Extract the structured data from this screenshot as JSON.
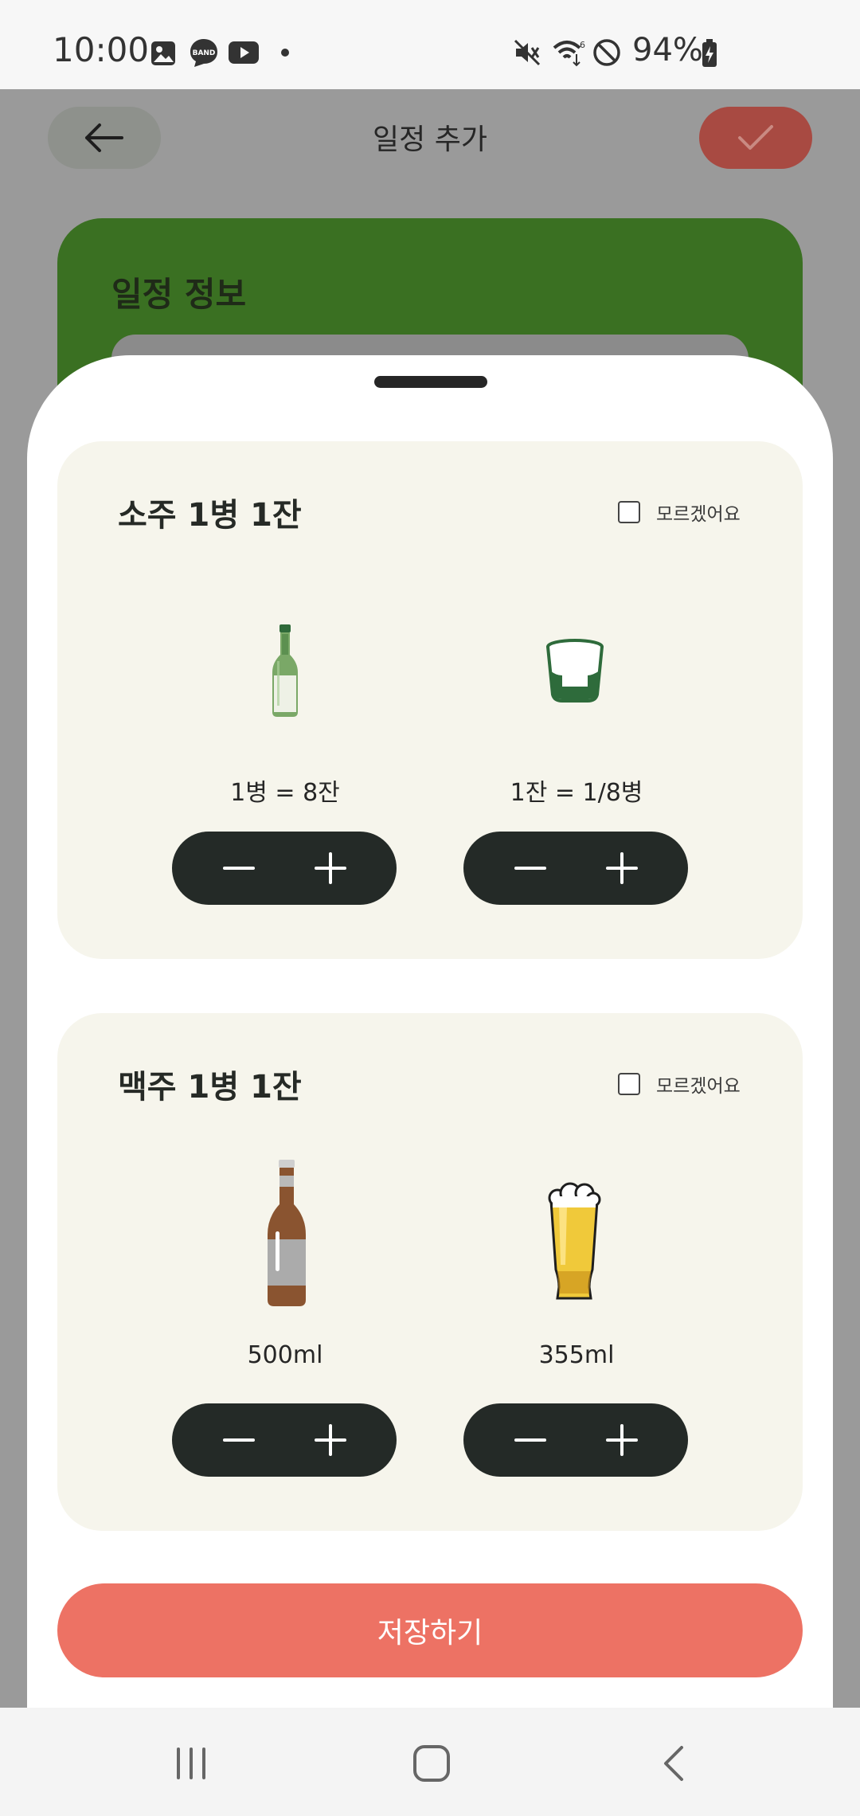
{
  "status_bar": {
    "time": "10:00",
    "battery": "94%",
    "icons_left": [
      "gallery-icon",
      "band-icon",
      "youtube-icon",
      "dot-icon"
    ],
    "icons_right": [
      "mute-icon",
      "wifi-icon",
      "do-not-disturb-icon",
      "battery-charging-icon"
    ]
  },
  "header": {
    "title": "일정 추가",
    "back_icon": "arrow-left-icon",
    "confirm_icon": "check-icon"
  },
  "schedule_info": {
    "title": "일정 정보"
  },
  "sections": [
    {
      "title": "소주 1병 1잔",
      "unknown_label": "모르겠어요",
      "items": [
        {
          "icon": "soju-bottle-icon",
          "label": "1병 = 8잔"
        },
        {
          "icon": "soju-glass-icon",
          "label": "1잔 = 1/8병"
        }
      ]
    },
    {
      "title": "맥주 1병 1잔",
      "unknown_label": "모르겠어요",
      "items": [
        {
          "icon": "beer-bottle-icon",
          "label": "500ml"
        },
        {
          "icon": "beer-glass-icon",
          "label": "355ml"
        }
      ]
    }
  ],
  "save_label": "저장하기",
  "colors": {
    "accent_green": "#3a7022",
    "save_button": "#ed7264",
    "stepper": "#242a27",
    "card_bg": "#f6f5ec"
  }
}
